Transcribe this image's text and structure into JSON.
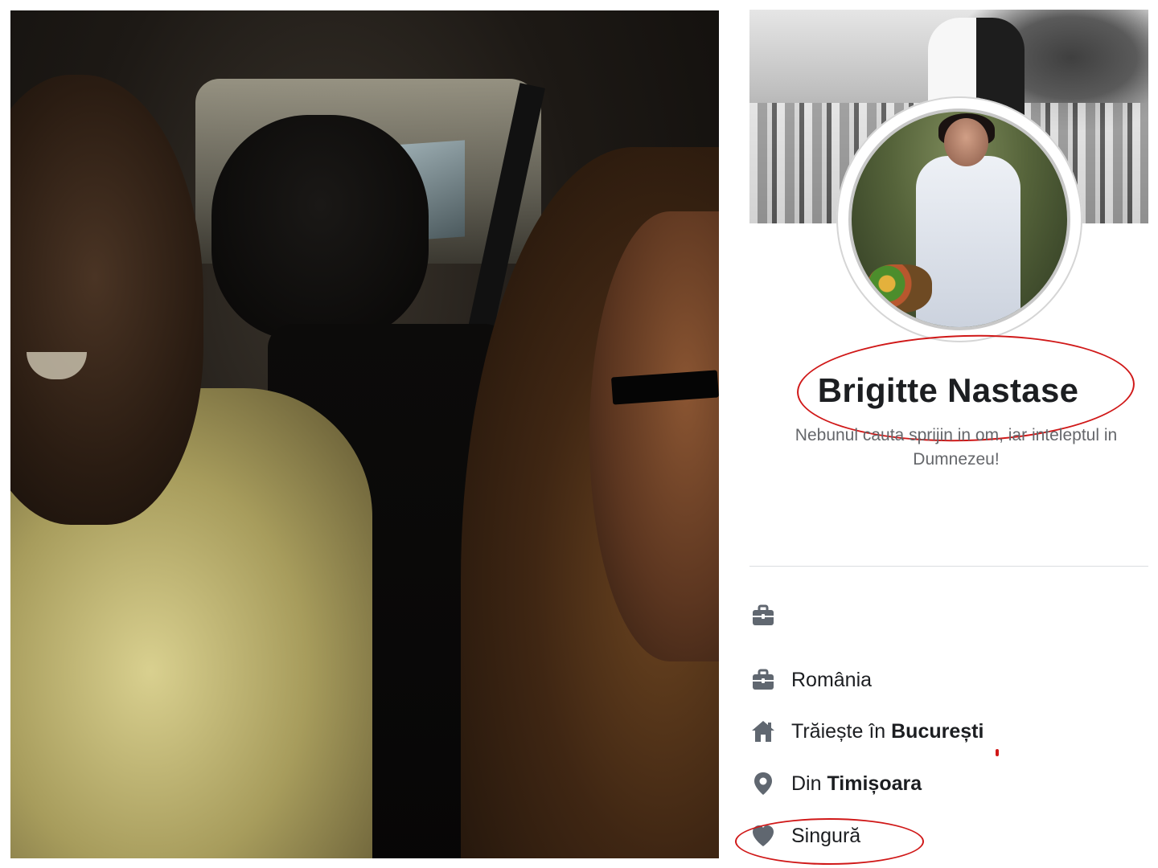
{
  "profile": {
    "name": "Brigitte Nastase",
    "bio": "Nebunul cauta sprijin in om, iar inteleptul in Dumnezeu!",
    "about": {
      "work_hidden": {
        "icon": "briefcase-icon",
        "text": ""
      },
      "work": {
        "icon": "briefcase-icon",
        "text": "România"
      },
      "lives": {
        "icon": "home-icon",
        "prefix": "Trăiește în ",
        "place": "București"
      },
      "from": {
        "icon": "location-pin-icon",
        "prefix": "Din ",
        "place": "Timișoara"
      },
      "relationship": {
        "icon": "heart-icon",
        "text": "Singură"
      }
    }
  },
  "colors": {
    "annotation_red": "#d01818",
    "text_primary": "#1c1e21",
    "text_secondary": "#65676b",
    "icon_grey": "#606770"
  }
}
